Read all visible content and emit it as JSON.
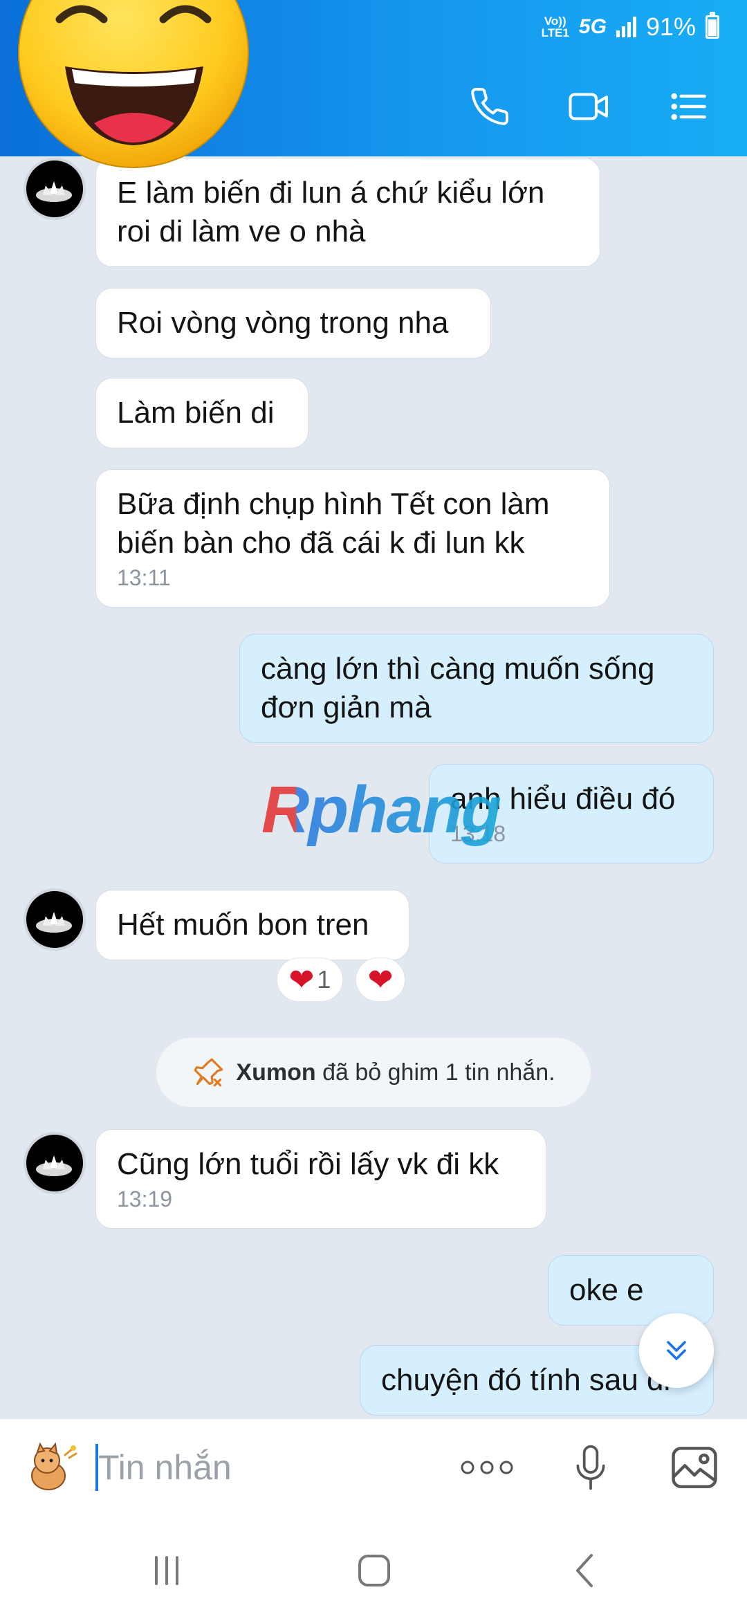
{
  "status_bar": {
    "volte": "Vo)) LTE1",
    "network": "5G",
    "battery": "91%"
  },
  "header": {
    "icons": [
      "phone-icon",
      "video-call-icon",
      "menu-list-icon"
    ]
  },
  "messages": [
    {
      "dir": "in",
      "text": "E làm biến đi lun á chứ kiểu lớn roi di làm ve o nhà",
      "time": ""
    },
    {
      "dir": "in",
      "text": "Roi vòng vòng trong nha",
      "time": ""
    },
    {
      "dir": "in",
      "text": "Làm biến di",
      "time": ""
    },
    {
      "dir": "in",
      "text": "Bữa định chụp hình Tết con làm biến bàn cho đã cái k đi lun kk",
      "time": "13:11"
    },
    {
      "dir": "out",
      "text": "càng lớn thì càng muốn sống đơn giản mà",
      "time": ""
    },
    {
      "dir": "out",
      "text": "anh hiểu điều đó",
      "time": "13:18"
    },
    {
      "dir": "in",
      "text": "Hết muốn bon tren",
      "time": ""
    },
    {
      "dir": "in",
      "text": "Cũng lớn tuổi rồi lấy vk đi kk",
      "time": "13:19"
    },
    {
      "dir": "out",
      "text": "oke e",
      "time": ""
    },
    {
      "dir": "out",
      "text": "chuyện đó tính sau di",
      "time": ""
    }
  ],
  "reactions": {
    "heart_count": "1",
    "heart_symbol": "❤"
  },
  "system_notice": {
    "name": "Xumon",
    "text": "đã bỏ ghim 1 tin nhắn."
  },
  "watermark": "Rphang",
  "input": {
    "placeholder": "Tin nhắn"
  },
  "colors": {
    "header": "#1595ee",
    "bubble_out": "#d5efff",
    "bubble_in": "#ffffff",
    "background": "#e2e8ef"
  }
}
